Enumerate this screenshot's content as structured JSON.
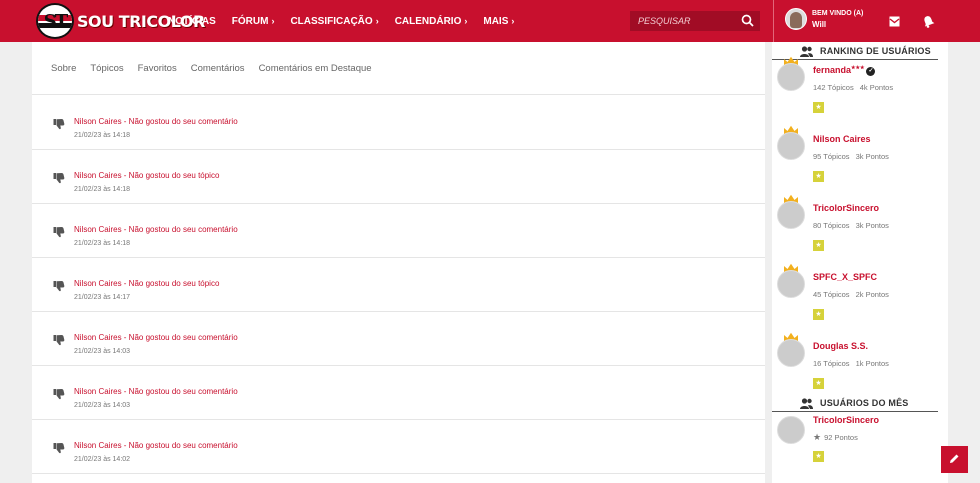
{
  "header": {
    "logo_text": "SOU TRICOLOR",
    "logo_badge_text": "ST",
    "nav": [
      {
        "label": "NOTÍCIAS",
        "has_chevron": false
      },
      {
        "label": "FÓRUM",
        "has_chevron": true
      },
      {
        "label": "CLASSIFICAÇÃO",
        "has_chevron": true
      },
      {
        "label": "CALENDÁRIO",
        "has_chevron": true
      },
      {
        "label": "MAIS",
        "has_chevron": true
      }
    ],
    "chevron": "›",
    "search_placeholder": "PESQUISAR",
    "user": {
      "welcome": "BEM VINDO (A)",
      "name": "Will"
    }
  },
  "tabs": [
    "Sobre",
    "Tópicos",
    "Favoritos",
    "Comentários",
    "Comentários em Destaque"
  ],
  "notifications": [
    {
      "text": "Nilson Caires - Não gostou do seu comentário",
      "date": "21/02/23 às 14:18"
    },
    {
      "text": "Nilson Caires - Não gostou do seu tópico",
      "date": "21/02/23 às 14:18"
    },
    {
      "text": "Nilson Caires - Não gostou do seu comentário",
      "date": "21/02/23 às 14:18"
    },
    {
      "text": "Nilson Caires - Não gostou do seu tópico",
      "date": "21/02/23 às 14:17"
    },
    {
      "text": "Nilson Caires - Não gostou do seu comentário",
      "date": "21/02/23 às 14:03"
    },
    {
      "text": "Nilson Caires - Não gostou do seu comentário",
      "date": "21/02/23 às 14:03"
    },
    {
      "text": "Nilson Caires - Não gostou do seu comentário",
      "date": "21/02/23 às 14:02"
    }
  ],
  "sidebar": {
    "ranking_title": "RANKING DE USUÁRIOS",
    "ranking": [
      {
        "name": "fernanda",
        "topics": "142 Tópicos",
        "points": "4k Pontos",
        "verified": true,
        "avatar": "av-fernanda",
        "flair": "★★★"
      },
      {
        "name": "Nilson Caires",
        "topics": "95 Tópicos",
        "points": "3k Pontos",
        "verified": false,
        "avatar": "av-nilson"
      },
      {
        "name": "TricolorSincero",
        "topics": "80 Tópicos",
        "points": "3k Pontos",
        "verified": false,
        "avatar": "av-tricolor"
      },
      {
        "name": "SPFC_X_SPFC",
        "topics": "45 Tópicos",
        "points": "2k Pontos",
        "verified": false,
        "avatar": "av-spfc"
      },
      {
        "name": "Douglas S.S.",
        "topics": "16 Tópicos",
        "points": "1k Pontos",
        "verified": false,
        "avatar": "av-douglas"
      }
    ],
    "month_title": "USUÁRIOS DO MÊS",
    "month_user": {
      "name": "TricolorSincero",
      "points": "92 Pontos",
      "avatar": "av-tricolor"
    }
  },
  "colors": {
    "brand": "#c8102e",
    "badge": "#d6d23a",
    "crown": "#f2b01e"
  }
}
